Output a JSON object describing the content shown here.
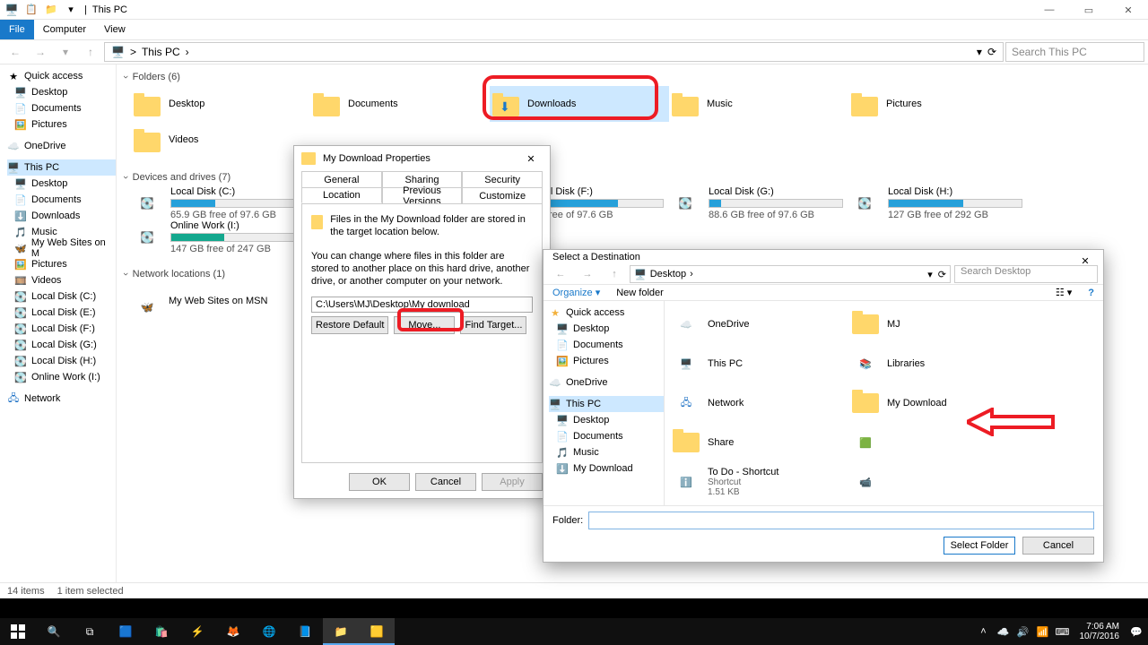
{
  "window": {
    "title": "This PC",
    "ribbon": [
      "File",
      "Computer",
      "View"
    ],
    "breadcrumb_sep": ">",
    "address": [
      "This PC"
    ],
    "search_placeholder": "Search This PC",
    "status_left": "14 items",
    "status_sel": "1 item selected"
  },
  "navpane": {
    "quick_access": "Quick access",
    "qa_items": [
      "Desktop",
      "Documents",
      "Pictures"
    ],
    "onedrive": "OneDrive",
    "thispc": "This PC",
    "pc_items": [
      "Desktop",
      "Documents",
      "Downloads",
      "Music",
      "My Web Sites on M",
      "Pictures",
      "Videos",
      "Local Disk (C:)",
      "Local Disk (E:)",
      "Local Disk (F:)",
      "Local Disk (G:)",
      "Local Disk (H:)",
      "Online Work (I:)"
    ],
    "network": "Network"
  },
  "sections": {
    "folders_hdr": "Folders (6)",
    "folders": [
      "Desktop",
      "Documents",
      "Downloads",
      "Music",
      "Pictures",
      "Videos"
    ],
    "drives_hdr": "Devices and drives (7)",
    "drives": [
      {
        "name": "Local Disk (C:)",
        "free": "65.9 GB free of 97.6 GB",
        "pct": 33
      },
      {
        "name": "Online Work (I:)",
        "free": "147 GB free of 247 GB",
        "pct": 40
      },
      {
        "name": "Local Disk (F:)",
        "free": "GB free of 97.6 GB",
        "pct": 66
      },
      {
        "name": "Local Disk (G:)",
        "free": "88.6 GB free of 97.6 GB",
        "pct": 9
      },
      {
        "name": "Local Disk (H:)",
        "free": "127 GB free of 292 GB",
        "pct": 56
      }
    ],
    "netloc_hdr": "Network locations (1)",
    "netloc": "My Web Sites on MSN"
  },
  "prop": {
    "title": "My Download Properties",
    "tabs": [
      "General",
      "Sharing",
      "Security",
      "Location",
      "Previous Versions",
      "Customize"
    ],
    "desc1": "Files in the My Download folder are stored in the target location below.",
    "desc2": "You can change where files in this folder are stored to another place on this hard drive, another drive, or another computer on your network.",
    "path": "C:\\Users\\MJ\\Desktop\\My download",
    "btn_restore": "Restore Default",
    "btn_move": "Move...",
    "btn_target": "Find Target...",
    "btn_ok": "OK",
    "btn_cancel": "Cancel",
    "btn_apply": "Apply"
  },
  "dest": {
    "title": "Select a Destination",
    "breadcrumb": "Desktop",
    "search_ph": "Search Desktop",
    "organize": "Organize",
    "newfolder": "New folder",
    "nav": {
      "quick_access": "Quick access",
      "qa": [
        "Desktop",
        "Documents",
        "Pictures"
      ],
      "onedrive": "OneDrive",
      "thispc": "This PC",
      "pc": [
        "Desktop",
        "Documents",
        "Music",
        "My Download"
      ]
    },
    "items_col1": [
      "OneDrive",
      "This PC",
      "Network",
      "Share",
      "To Do - Shortcut"
    ],
    "todo_sub1": "Shortcut",
    "todo_sub2": "1.51 KB",
    "items_col2": [
      "MJ",
      "Libraries",
      "My Download"
    ],
    "folder_label": "Folder:",
    "btn_select": "Select Folder",
    "btn_cancel": "Cancel"
  },
  "tray": {
    "time": "7:06 AM",
    "date": "10/7/2016"
  }
}
